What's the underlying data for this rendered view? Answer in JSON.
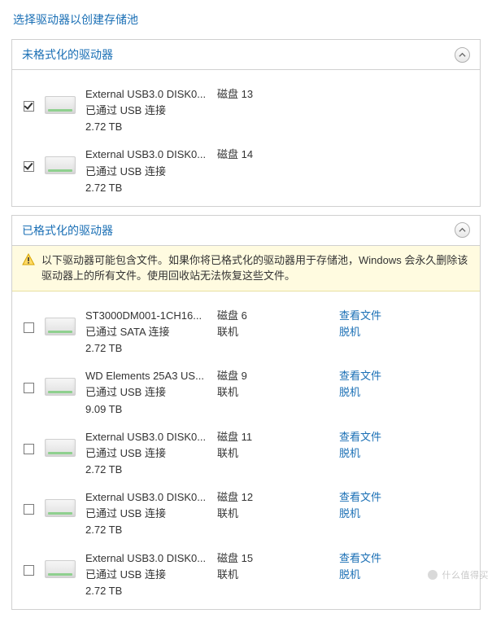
{
  "page_title": "选择驱动器以创建存储池",
  "panels": {
    "unformatted": {
      "title": "未格式化的驱动器",
      "drives": [
        {
          "checked": true,
          "name": "External USB3.0 DISK0...",
          "conn": "已通过 USB 连接",
          "size": "2.72 TB",
          "disk": "磁盘 13"
        },
        {
          "checked": true,
          "name": "External USB3.0 DISK0...",
          "conn": "已通过 USB 连接",
          "size": "2.72 TB",
          "disk": "磁盘 14"
        }
      ]
    },
    "formatted": {
      "title": "已格式化的驱动器",
      "warning": "以下驱动器可能包含文件。如果你将已格式化的驱动器用于存储池，Windows 会永久删除该驱动器上的所有文件。使用回收站无法恢复这些文件。",
      "view_label": "查看文件",
      "offline_label": "脱机",
      "status_label": "联机",
      "drives": [
        {
          "checked": false,
          "name": "ST3000DM001-1CH16...",
          "conn": "已通过 SATA 连接",
          "size": "2.72 TB",
          "disk": "磁盘 6"
        },
        {
          "checked": false,
          "name": "WD Elements 25A3 US...",
          "conn": "已通过 USB 连接",
          "size": "9.09 TB",
          "disk": "磁盘 9"
        },
        {
          "checked": false,
          "name": "External USB3.0 DISK0...",
          "conn": "已通过 USB 连接",
          "size": "2.72 TB",
          "disk": "磁盘 11"
        },
        {
          "checked": false,
          "name": "External USB3.0 DISK0...",
          "conn": "已通过 USB 连接",
          "size": "2.72 TB",
          "disk": "磁盘 12"
        },
        {
          "checked": false,
          "name": "External USB3.0 DISK0...",
          "conn": "已通过 USB 连接",
          "size": "2.72 TB",
          "disk": "磁盘 15"
        }
      ]
    }
  },
  "watermark": "什么值得买"
}
